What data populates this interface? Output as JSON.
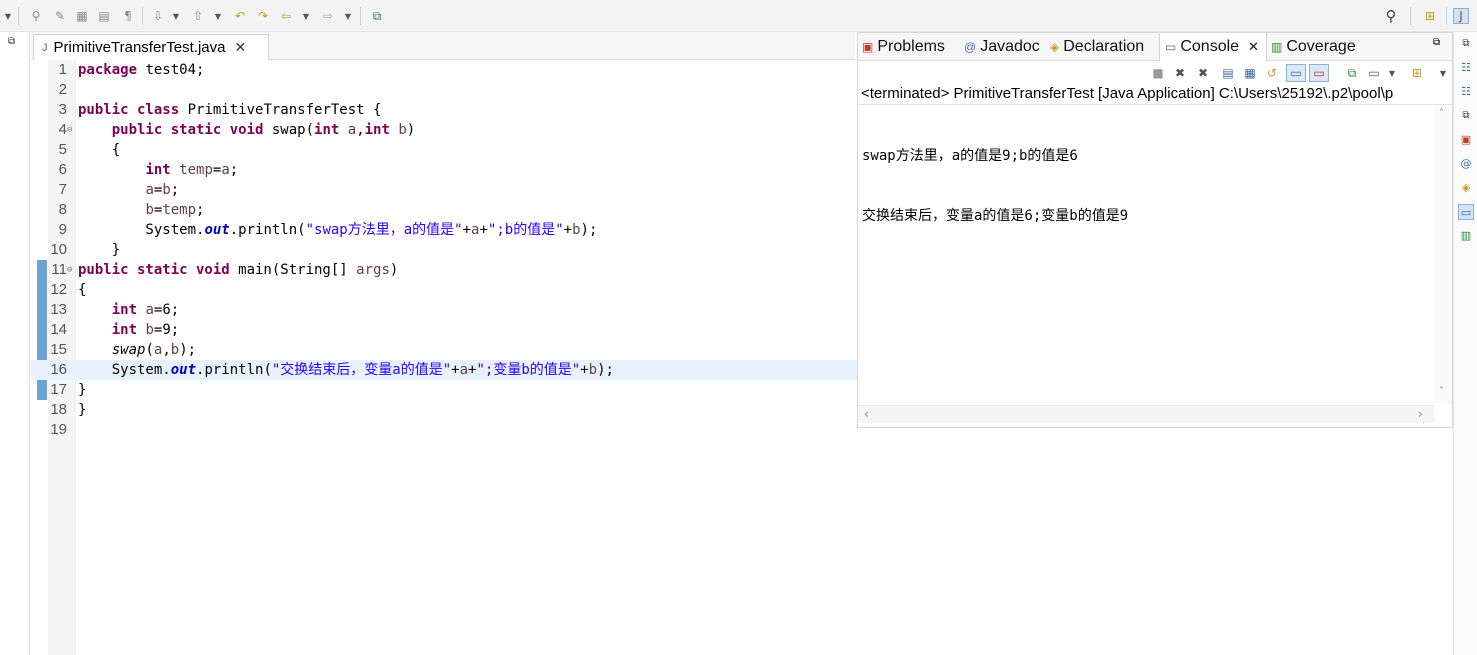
{
  "editor": {
    "tab_title": "PrimitiveTransferTest.java",
    "lines": [
      {
        "n": "1",
        "html": "<span class='kw'>package</span> test04;"
      },
      {
        "n": "2",
        "html": ""
      },
      {
        "n": "3",
        "html": "<span class='kw'>public class</span> PrimitiveTransferTest {"
      },
      {
        "n": "4",
        "html": "    <span class='kw'>public static void</span> swap(<span class='kw'>int</span> <span class='var'>a</span>,<span class='kw'>int</span> <span class='var'>b</span>)"
      },
      {
        "n": "5",
        "html": "    {"
      },
      {
        "n": "6",
        "html": "        <span class='kw'>int</span> <span class='var'>temp</span>=<span class='var'>a</span>;"
      },
      {
        "n": "7",
        "html": "        <span class='var'>a</span>=<span class='var'>b</span>;"
      },
      {
        "n": "8",
        "html": "        <span class='var'>b</span>=<span class='var'>temp</span>;"
      },
      {
        "n": "9",
        "html": "        System.<span class='fld'>out</span>.println(<span class='str'>\"swap方法里，a的值是\"</span>+<span class='var'>a</span>+<span class='str'>\";b的值是\"</span>+<span class='var'>b</span>);"
      },
      {
        "n": "10",
        "html": "    }"
      },
      {
        "n": "11",
        "html": "<span class='kw'>public static void</span> main(String[] <span class='var'>args</span>)"
      },
      {
        "n": "12",
        "html": "{"
      },
      {
        "n": "13",
        "html": "    <span class='kw'>int</span> <span class='var'>a</span>=6;"
      },
      {
        "n": "14",
        "html": "    <span class='kw'>int</span> <span class='var'>b</span>=9;"
      },
      {
        "n": "15",
        "html": "    <span class='it'>swap</span>(<span class='var'>a</span>,<span class='var'>b</span>);"
      },
      {
        "n": "16",
        "html": "    System.<span class='fld'>out</span>.println(<span class='str'>\"交换结束后，变量a的值是\"</span>+<span class='var'>a</span>+<span class='str'>\";变量b的值是\"</span>+<span class='var'>b</span>);"
      },
      {
        "n": "17",
        "html": "}"
      },
      {
        "n": "18",
        "html": "}"
      },
      {
        "n": "19",
        "html": ""
      }
    ]
  },
  "views": {
    "tabs": [
      "Problems",
      "Javadoc",
      "Declaration",
      "Console",
      "Coverage"
    ],
    "active": "Console"
  },
  "console": {
    "header": "<terminated> PrimitiveTransferTest [Java Application] C:\\Users\\25192\\.p2\\pool\\p",
    "output": [
      "swap方法里，a的值是9;b的值是6",
      "交换结束后，变量a的值是6;变量b的值是9"
    ]
  },
  "icons": [
    "search-icon",
    "maximize-icon",
    "close-icon",
    "terminate-icon",
    "remove-launch-icon",
    "remove-all-icon",
    "scroll-lock-icon",
    "pin-console-icon",
    "open-console-icon"
  ]
}
